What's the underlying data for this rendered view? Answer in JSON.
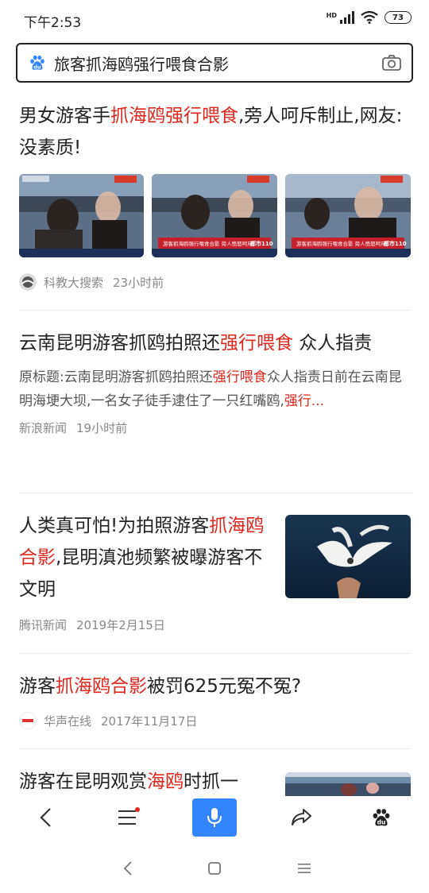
{
  "status_bar": {
    "time": "下午2:53",
    "network": "HD",
    "battery": "73"
  },
  "search": {
    "query": "旅客抓海鸥强行喂食合影",
    "logo": "baidu-paw-icon",
    "camera": "camera-icon"
  },
  "results": [
    {
      "title_parts": [
        "男女游客手",
        "抓海鸥强行喂食",
        ",旁人呵斥制止,网友:没素质!"
      ],
      "source": "科教大搜索",
      "time": "23小时前",
      "thumbnails": [
        "news-video-frame-1",
        "news-video-frame-2",
        "news-video-frame-3"
      ],
      "tv_ticker": [
        "游客抓海鸥强行喂食合影 旁人愤怒呵斥",
        "都市110"
      ]
    },
    {
      "title_parts": [
        "云南昆明游客抓鸥拍照还",
        "强行喂食",
        " 众人指责"
      ],
      "summary_parts": [
        "原标题:云南昆明游客抓鸥拍照还",
        "强行喂食",
        "众人指责日前在云南昆明海埂大坝,一名女子徒手逮住了一只红嘴鸥,",
        "强行..."
      ],
      "source": "新浪新闻",
      "time": "19小时前"
    },
    {
      "title_parts": [
        "人类真可怕!为拍照游客",
        "抓海鸥合影",
        ",昆明滇池频繁被曝游客不文明"
      ],
      "source": "腾讯新闻",
      "time": "2019年2月15日"
    },
    {
      "title_parts": [
        "游客",
        "抓海鸥合影",
        "被罚625元冤不冤?"
      ],
      "source": "华声在线",
      "time": "2017年11月17日"
    },
    {
      "title_parts": [
        "游客在昆明观赏",
        "海鸥",
        "时抓一"
      ]
    }
  ],
  "toolbar": {
    "items": [
      "back-icon",
      "menu-icon",
      "voice-search-icon",
      "share-icon",
      "baidu-paw-icon"
    ],
    "accent": "#3385ff",
    "highlight": "#e0271c"
  }
}
